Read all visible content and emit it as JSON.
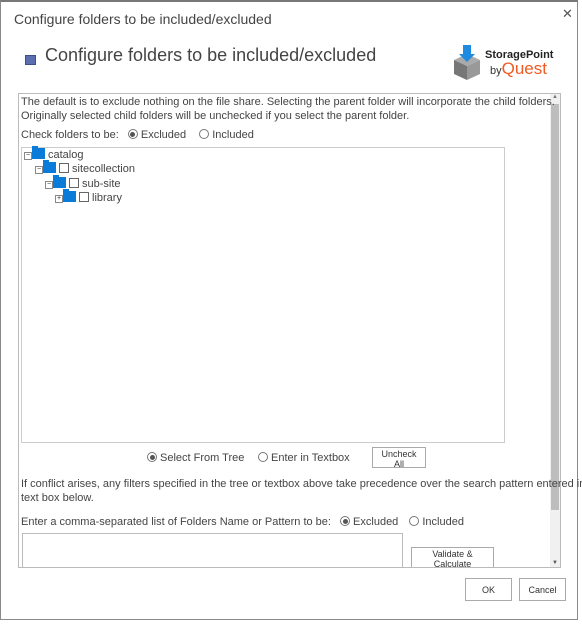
{
  "window": {
    "title": "Configure folders to be included/excluded",
    "close_icon": "close-icon"
  },
  "header": {
    "title": "Configure folders to be included/excluded",
    "icon": "list-icon",
    "logo": {
      "line1": "StoragePoint",
      "line2_by": "by",
      "line2_brand": "Quest",
      "brand_color": "#f15a22"
    }
  },
  "panel": {
    "intro_line1": "The default is to exclude nothing on the file share. Selecting the parent folder will incorporate the child folders.",
    "intro_line2": "Originally selected child folders will be unchecked if you select the parent folder.",
    "check_label": "Check folders to be:",
    "check_options": [
      {
        "label": "Excluded",
        "selected": true
      },
      {
        "label": "Included",
        "selected": false
      }
    ],
    "tree": [
      {
        "label": "catalog",
        "expanded": true,
        "checkbox": false
      },
      {
        "label": "sitecollection",
        "expanded": true,
        "checkbox": true,
        "checked": false
      },
      {
        "label": "sub-site",
        "expanded": true,
        "checkbox": true,
        "checked": false
      },
      {
        "label": "library",
        "expanded": false,
        "checkbox": true,
        "checked": false
      }
    ],
    "mode_options": [
      {
        "label": "Select From Tree",
        "selected": true
      },
      {
        "label": "Enter in Textbox",
        "selected": false
      }
    ],
    "uncheck_all": "Uncheck All",
    "conflict_line1": "If conflict arises, any filters specified in the tree or textbox above take precedence over the search pattern entered in the",
    "conflict_line2": "text box below.",
    "pattern_label": "Enter a comma-separated list of Folders Name or Pattern to be:",
    "pattern_options": [
      {
        "label": "Excluded",
        "selected": true
      },
      {
        "label": "Included",
        "selected": false
      }
    ],
    "pattern_value": "",
    "validate": "Validate & Calculate"
  },
  "footer": {
    "ok": "OK",
    "cancel": "Cancel"
  },
  "colors": {
    "folder": "#0a7bd8",
    "brand": "#f15a22"
  }
}
